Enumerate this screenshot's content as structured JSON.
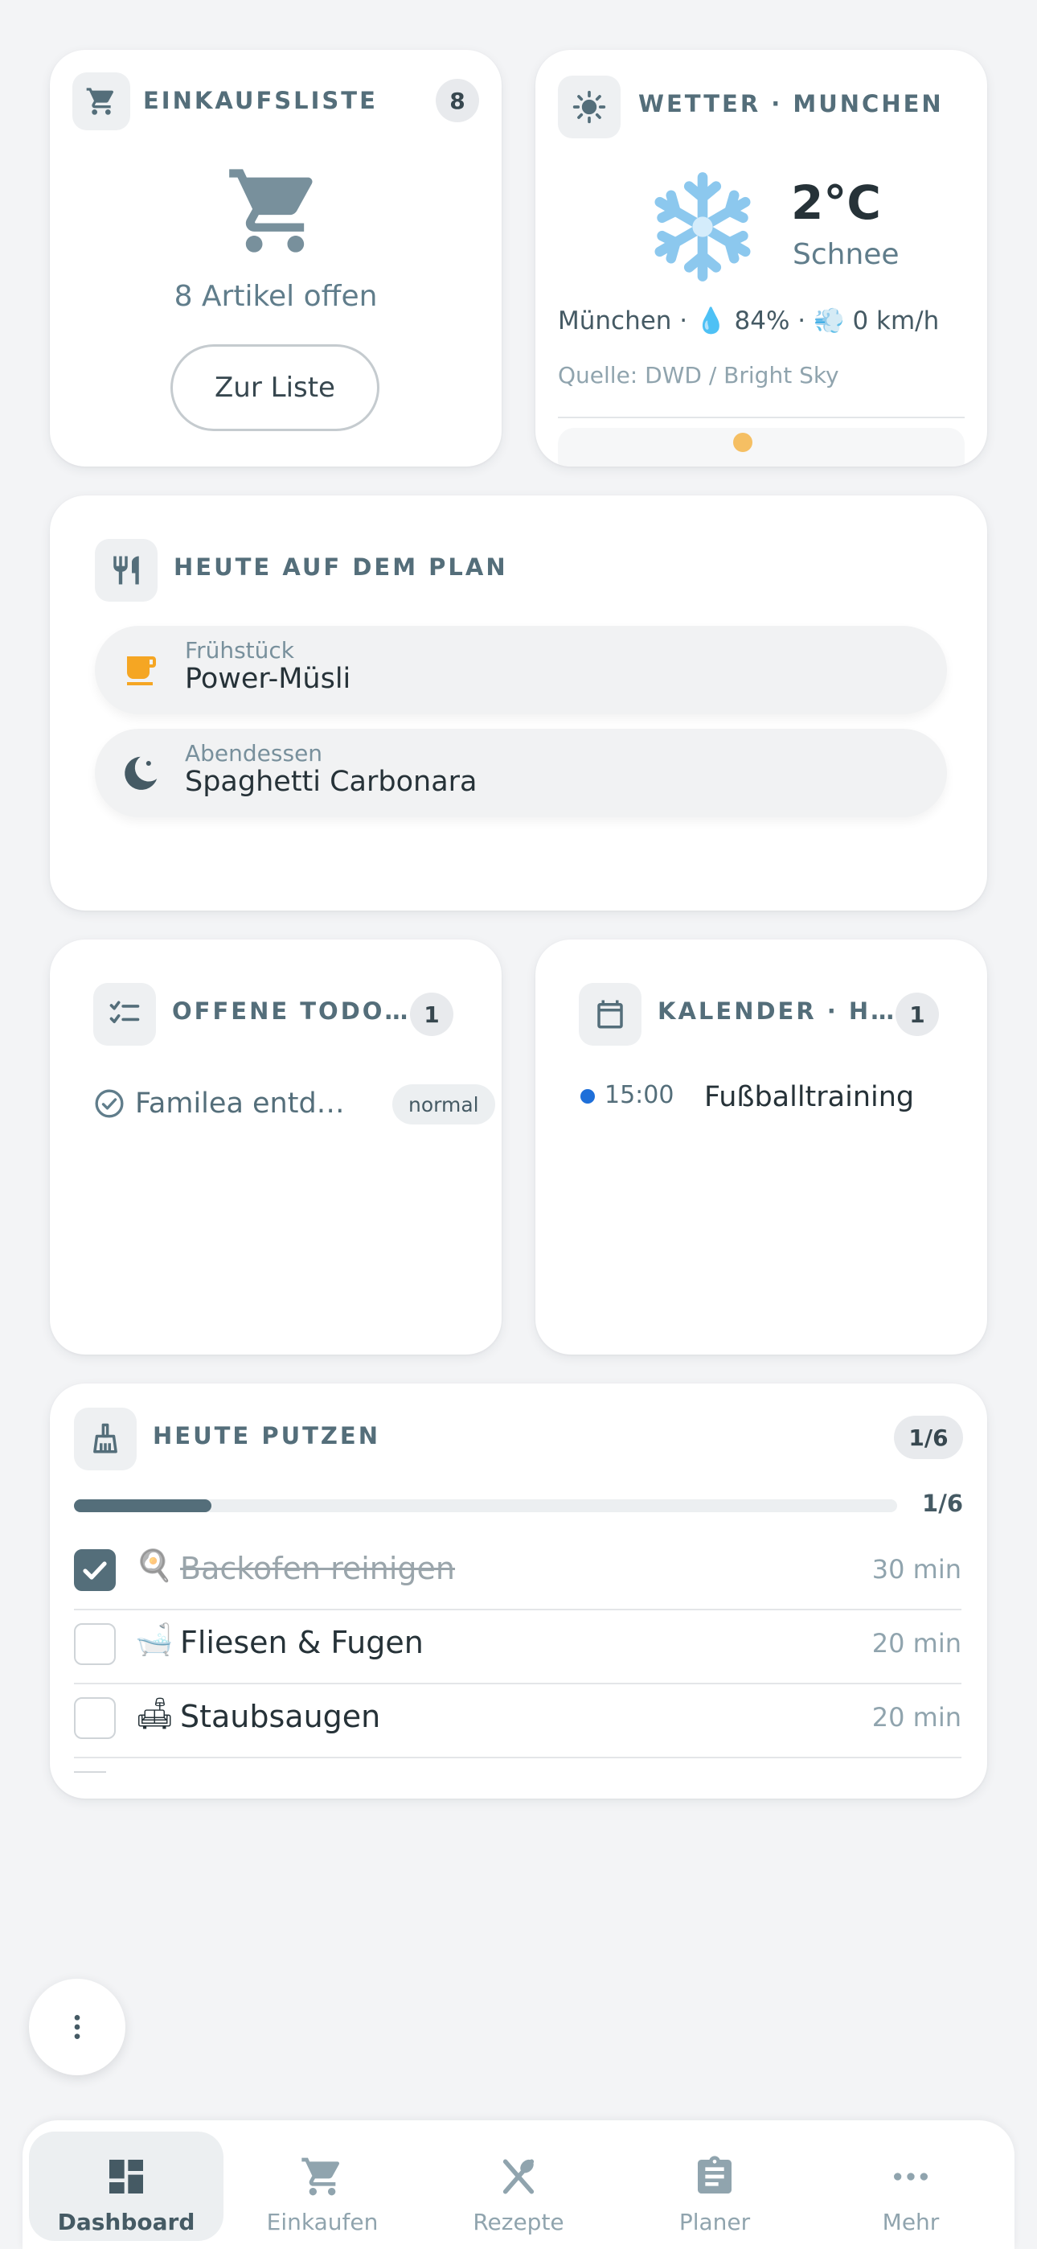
{
  "shopping": {
    "title": "EINKAUFSLISTE",
    "badge": "8",
    "summary": "8 Artikel offen",
    "button": "Zur Liste",
    "icon": "cart-icon"
  },
  "weather": {
    "title": "WETTER · MUNCHEN",
    "temperature": "2°C",
    "condition": "Schnee",
    "city": "München ·",
    "humidity": "84% ·",
    "wind": "0 km/h",
    "source": "Quelle: DWD / Bright Sky",
    "icon": "snowflake-icon"
  },
  "meals": {
    "title": "HEUTE AUF DEM PLAN",
    "items": [
      {
        "label": "Frühstück",
        "value": "Power-Müsli",
        "icon": "coffee-cup-icon"
      },
      {
        "label": "Abendessen",
        "value": "Spaghetti Carbonara",
        "icon": "moon-icon"
      }
    ]
  },
  "todos": {
    "title": "OFFENE TODO…",
    "badge": "1",
    "items": [
      {
        "text": "Familea entd…",
        "tag": "normal"
      }
    ]
  },
  "calendar": {
    "title": "KALENDER · H…",
    "badge": "1",
    "events": [
      {
        "time": "15:00",
        "title": "Fußballtraining"
      }
    ]
  },
  "chores": {
    "title": "HEUTE PUTZEN",
    "badge": "1/6",
    "progress_label": "1/6",
    "progress_fraction": 0.167,
    "items": [
      {
        "emoji": "🍳",
        "name": "Backofen reinigen",
        "duration": "30 min",
        "done": true
      },
      {
        "emoji": "🛁",
        "name": "Fliesen & Fugen",
        "duration": "20 min",
        "done": false
      },
      {
        "emoji": "🛋",
        "name": "Staubsaugen",
        "duration": "20 min",
        "done": false
      }
    ]
  },
  "nav": {
    "items": [
      {
        "label": "Dashboard",
        "icon": "dashboard-icon",
        "active": true
      },
      {
        "label": "Einkaufen",
        "icon": "cart-icon",
        "active": false
      },
      {
        "label": "Rezepte",
        "icon": "cutlery-icon",
        "active": false
      },
      {
        "label": "Planer",
        "icon": "clipboard-icon",
        "active": false
      },
      {
        "label": "Mehr",
        "icon": "more-horizontal-icon",
        "active": false
      }
    ]
  },
  "colors": {
    "accent": "#546e7a",
    "background": "#f3f4f6",
    "card": "#ffffff",
    "calendar_dot": "#1e6fd9",
    "sun": "#f5a623"
  }
}
